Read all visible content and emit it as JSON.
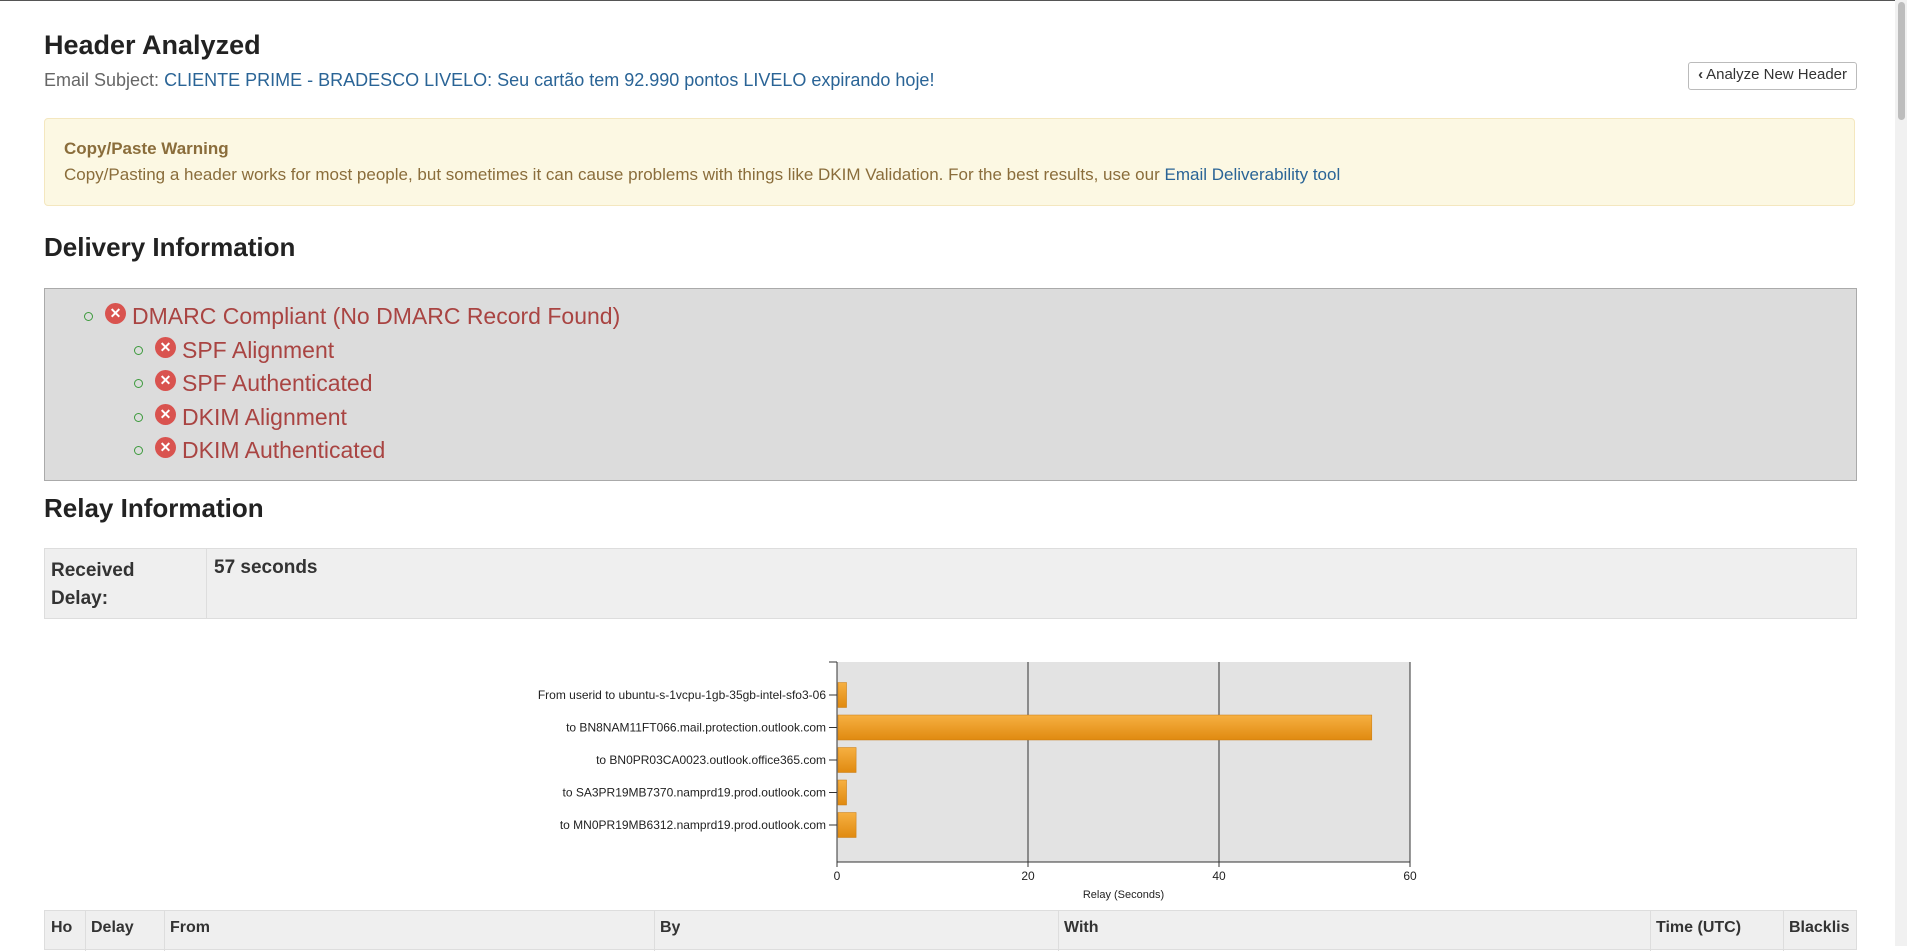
{
  "header": {
    "title": "Header Analyzed",
    "subject_label": "Email Subject:",
    "subject_value": "CLIENTE PRIME - BRADESCO LIVELO: Seu cartão tem 92.990 pontos LIVELO expirando hoje!",
    "analyze_button": "Analyze New Header",
    "analyze_button_icon": "chevron-left-icon"
  },
  "warning": {
    "title": "Copy/Paste Warning",
    "text": "Copy/Pasting a header works for most people, but sometimes it can cause problems with things like DKIM Validation. For the best results, use our",
    "link": "Email Deliverability tool"
  },
  "delivery": {
    "heading": "Delivery Information",
    "dmarc": "DMARC Compliant (No DMARC Record Found)",
    "checks": [
      "SPF Alignment",
      "SPF Authenticated",
      "DKIM Alignment",
      "DKIM Authenticated"
    ],
    "status_icon": "x-circle-icon",
    "fail_color": "#a94442"
  },
  "relay": {
    "heading": "Relay Information",
    "received_delay_label": "Received Delay:",
    "received_delay_value": "57 seconds"
  },
  "chart_data": {
    "type": "bar",
    "orientation": "horizontal",
    "categories": [
      "From  userid  to  ubuntu-s-1vcpu-1gb-35gb-intel-sfo3-06",
      "to  BN8NAM11FT066.mail.protection.outlook.com",
      "to  BN0PR03CA0023.outlook.office365.com",
      "to  SA3PR19MB7370.namprd19.prod.outlook.com",
      "to  MN0PR19MB6312.namprd19.prod.outlook.com"
    ],
    "values": [
      1,
      56,
      2,
      1,
      2
    ],
    "xlabel": "Relay (Seconds)",
    "xlim": [
      0,
      60
    ],
    "xticks": [
      0,
      20,
      40,
      60
    ],
    "grid": true,
    "bar_color": "#f0a020",
    "bg_color": "#e3e3e3"
  },
  "hop_table": {
    "headers": [
      "Ho",
      "Delay",
      "From",
      "By",
      "With",
      "Time (UTC)",
      "Blacklis"
    ]
  }
}
